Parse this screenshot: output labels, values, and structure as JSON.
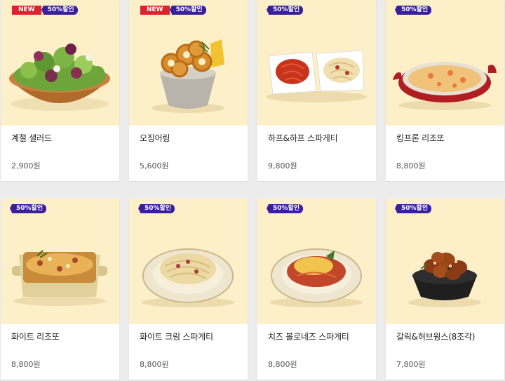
{
  "badges": {
    "new": "NEW",
    "sale": "50%할인"
  },
  "products": [
    {
      "name": "계절 샐러드",
      "price": "2,900원",
      "is_new": true,
      "image": "salad-bowl-image"
    },
    {
      "name": "오징어링",
      "price": "5,600원",
      "is_new": true,
      "image": "squid-rings-image"
    },
    {
      "name": "하프&하프 스파게티",
      "price": "9,800원",
      "is_new": false,
      "image": "half-half-spaghetti-image"
    },
    {
      "name": "킹프론 리조또",
      "price": "8,800원",
      "is_new": false,
      "image": "king-prawn-risotto-image"
    },
    {
      "name": "화이트 리조또",
      "price": "8,800원",
      "is_new": false,
      "image": "white-risotto-image"
    },
    {
      "name": "화이트 크림 스파게티",
      "price": "8,800원",
      "is_new": false,
      "image": "white-cream-spaghetti-image"
    },
    {
      "name": "치즈 볼로네즈 스파게티",
      "price": "8,800원",
      "is_new": false,
      "image": "cheese-bolognese-spaghetti-image"
    },
    {
      "name": "갈릭&허브윙스(8조각)",
      "price": "7,800원",
      "is_new": false,
      "image": "garlic-herb-wings-image"
    }
  ]
}
